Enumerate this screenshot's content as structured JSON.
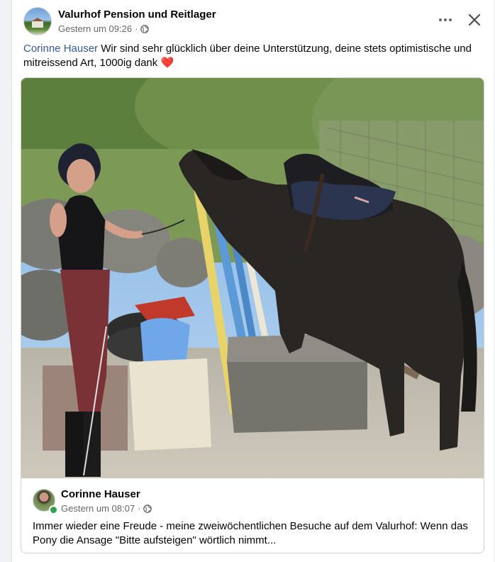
{
  "post": {
    "page_name": "Valurhof Pension und Reitlager",
    "timestamp": "Gestern um 09:26",
    "separator": "·",
    "audience_icon": "globe-icon",
    "mention": "Corinne Hauser",
    "text_after_mention": " Wir sind sehr glücklich über deine Unterstützung, deine stets optimistische und mitreissend Art, 1000ig dank ",
    "heart": "❤️"
  },
  "shared": {
    "author_name": "Corinne Hauser",
    "timestamp": "Gestern um 08:07",
    "separator": "·",
    "audience_icon": "globe-icon",
    "text": "Immer wieder eine Freude - meine zweiwöchentlichen Besuche auf dem Valurhof: Wenn das Pony die Ansage \"Bitte aufsteigen\" wörtlich nimmt..."
  },
  "colors": {
    "link": "#385898",
    "meta_text": "#65676b",
    "online": "#31a24c",
    "heart": "#e41e3f"
  }
}
